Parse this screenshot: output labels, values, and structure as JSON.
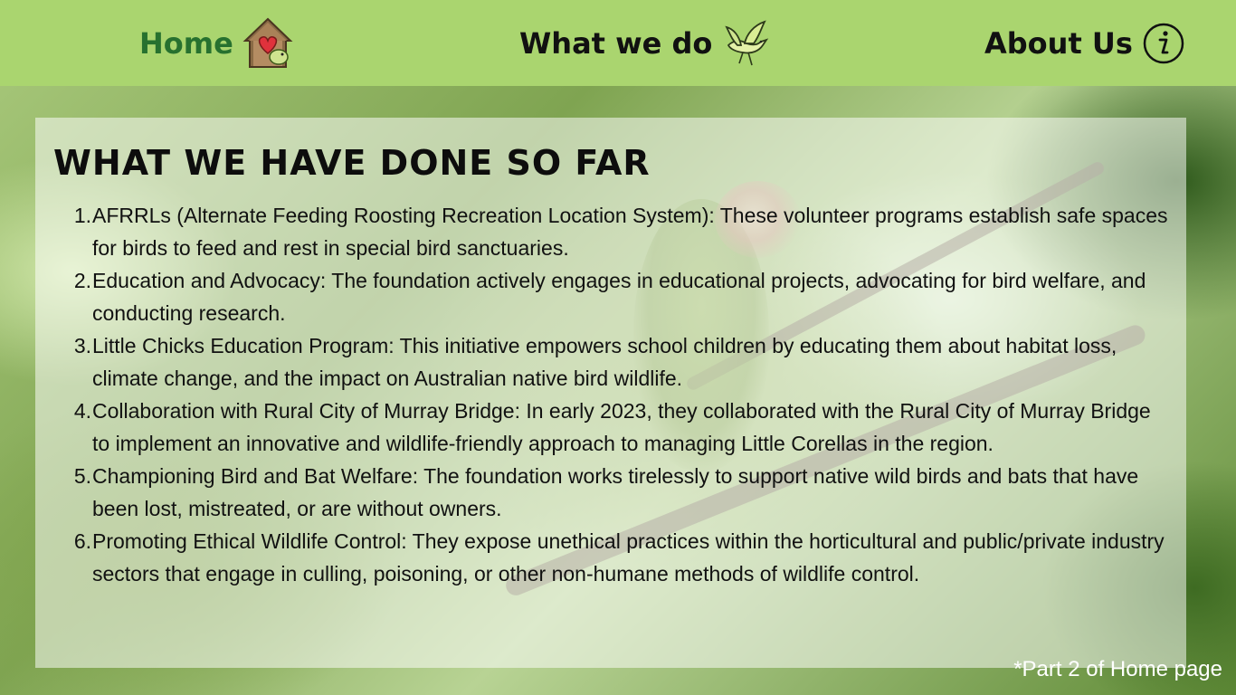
{
  "nav": {
    "home_label": "Home",
    "home_icon": "birdhouse-heart-icon",
    "what_label": "What we do",
    "what_icon": "flying-bird-icon",
    "about_label": "About Us",
    "about_icon": "info-circle-icon",
    "background_color": "#aad56f",
    "home_color": "#27712f"
  },
  "section": {
    "title": "WHAT WE HAVE DONE SO FAR",
    "items": [
      {
        "number": "1.",
        "text": "AFRRLs (Alternate Feeding Roosting Recreation Location System): These volunteer programs establish safe spaces for birds to feed and rest in special bird sanctuaries."
      },
      {
        "number": "2.",
        "text": "Education and Advocacy: The foundation actively engages in educational projects, advocating for bird welfare, and conducting research."
      },
      {
        "number": "3.",
        "text": "Little Chicks Education Program: This initiative empowers school children by educating them about habitat loss, climate change, and the impact on Australian native bird wildlife."
      },
      {
        "number": "4.",
        "text": "Collaboration with Rural City of Murray Bridge: In early 2023, they collaborated with the Rural City of Murray Bridge to implement an innovative and wildlife-friendly approach to managing Little Corellas in the region."
      },
      {
        "number": "5.",
        "text": "Championing Bird and Bat Welfare: The foundation works tirelessly to support native wild birds and bats that have been lost, mistreated, or are without owners."
      },
      {
        "number": "6.",
        "text": "Promoting Ethical Wildlife Control: They expose unethical practices within the horticultural and public/private industry sectors that engage in culling, poisoning, or other non-humane methods of wildlife control."
      }
    ]
  },
  "footnote": "*Part 2 of Home page"
}
